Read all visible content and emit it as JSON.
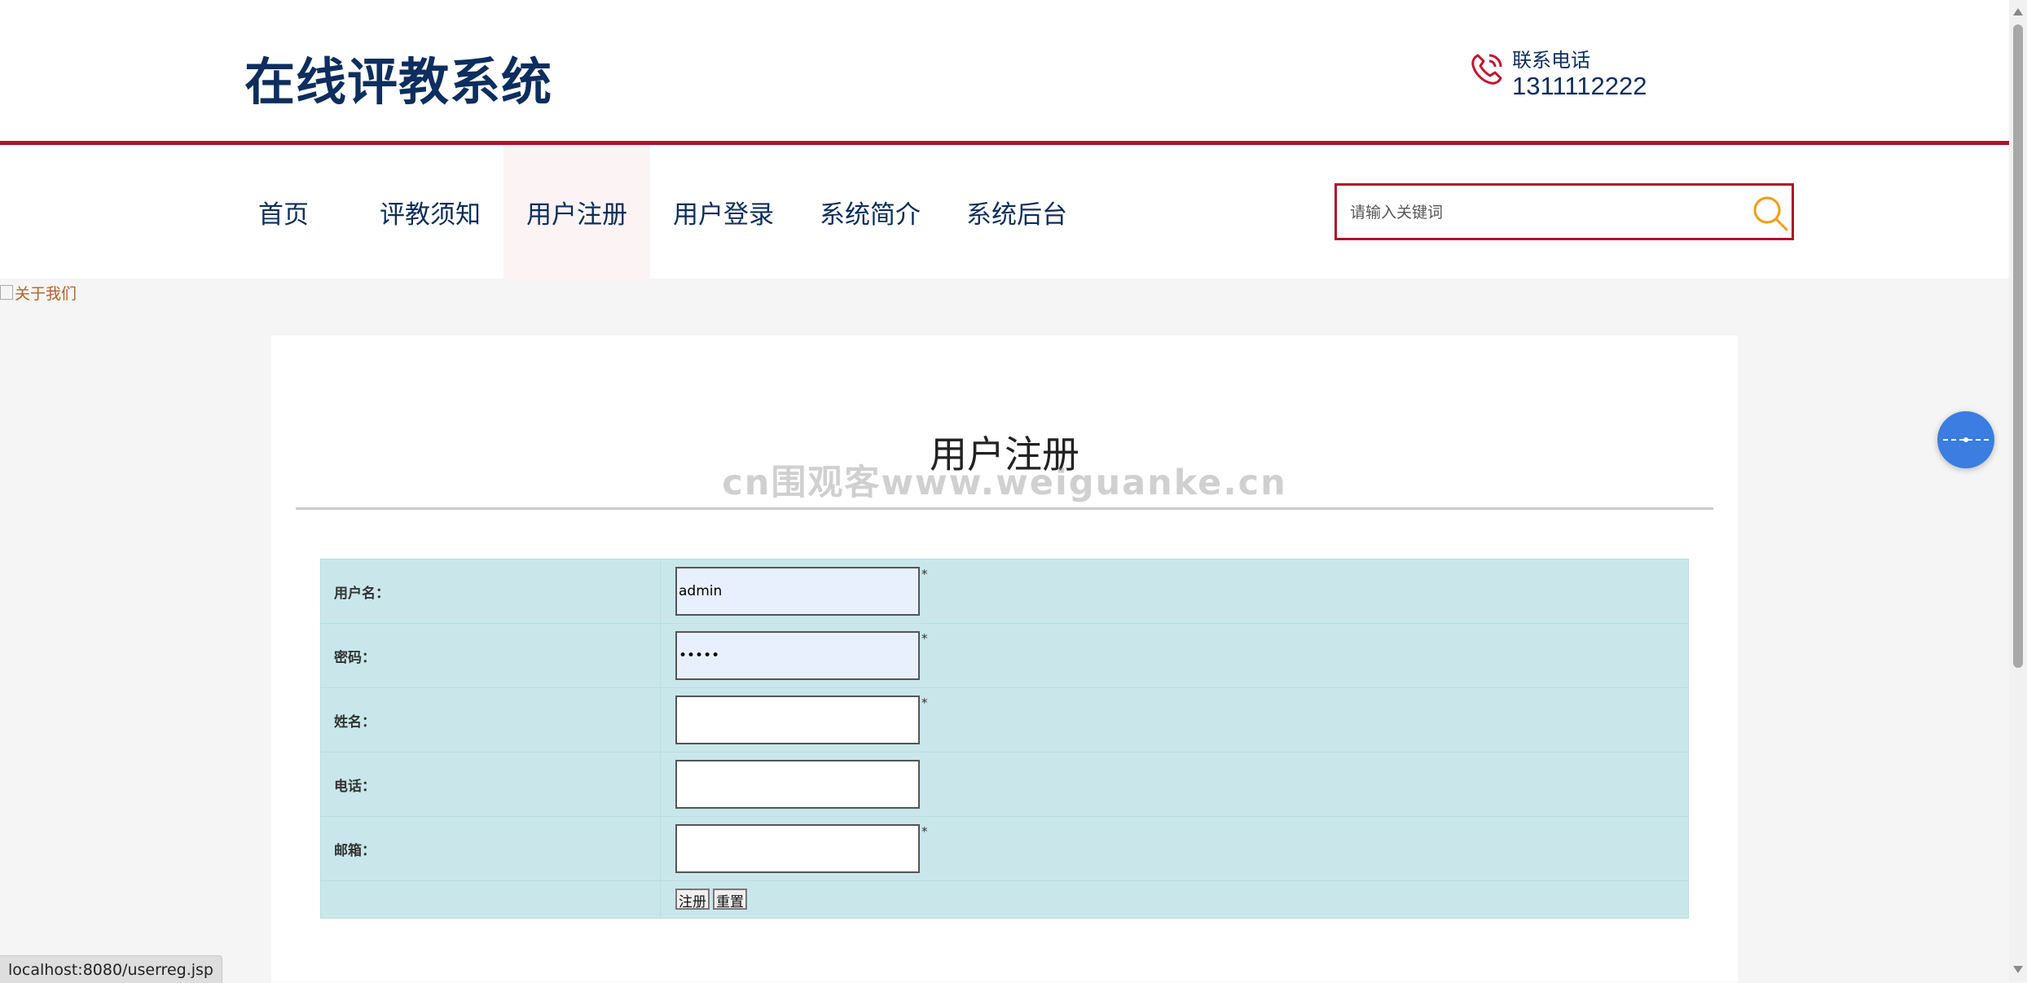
{
  "header": {
    "site_title": "在线评教系统",
    "phone_label": "联系电话",
    "phone_number": "1311112222"
  },
  "nav": {
    "items": [
      {
        "label": "首页"
      },
      {
        "label": "评教须知"
      },
      {
        "label": "用户注册",
        "active": true
      },
      {
        "label": "用户登录"
      },
      {
        "label": "系统简介"
      },
      {
        "label": "系统后台"
      }
    ]
  },
  "search": {
    "placeholder": "请输入关键词",
    "icon": "search-icon"
  },
  "banner_alt": "关于我们",
  "page": {
    "title": "用户注册",
    "watermark": "cn围观客www.weiguanke.cn"
  },
  "form": {
    "fields": [
      {
        "label": "用户名：",
        "value": "admin",
        "required": true
      },
      {
        "label": "密码：",
        "value": "•••••",
        "required": true
      },
      {
        "label": "姓名：",
        "value": "",
        "required": true
      },
      {
        "label": "电话：",
        "value": "",
        "required": false
      },
      {
        "label": "邮箱：",
        "value": "",
        "required": true
      }
    ],
    "required_mark": "*",
    "submit_label": "注册",
    "reset_label": "重置"
  },
  "status_bar": {
    "url": "localhost:8080/userreg.jsp"
  },
  "colors": {
    "brand_navy": "#0d2e5e",
    "accent_red": "#b0122a",
    "form_bg": "#c9e7ea",
    "search_icon": "#f39c12",
    "float_button": "#3b7de0"
  }
}
